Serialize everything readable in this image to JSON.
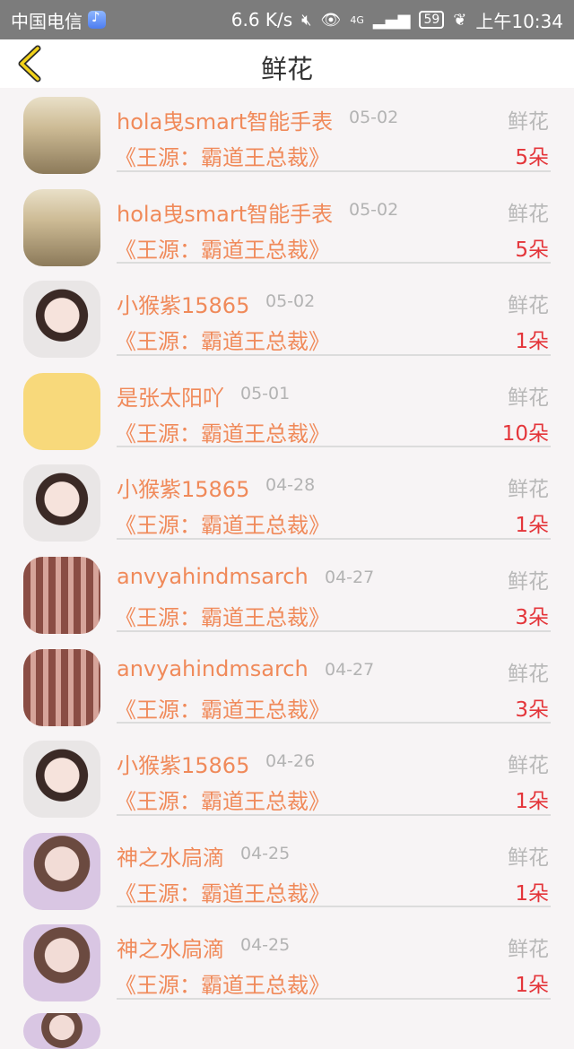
{
  "status_bar": {
    "carrier": "中国电信",
    "speed": "6.6 K/s",
    "signal": "4G",
    "battery": "59",
    "time": "上午10:34"
  },
  "header": {
    "title": "鲜花",
    "back_icon": "chevron-left-icon"
  },
  "rows": [
    {
      "name": "hola曳smart智能手表",
      "date": "05-02",
      "type": "鲜花",
      "work": "《王源：霸道王总裁》",
      "count": "5朵",
      "avatar": "alpaca"
    },
    {
      "name": "hola曳smart智能手表",
      "date": "05-02",
      "type": "鲜花",
      "work": "《王源：霸道王总裁》",
      "count": "5朵",
      "avatar": "alpaca"
    },
    {
      "name": "小猴紫15865",
      "date": "05-02",
      "type": "鲜花",
      "work": "《王源：霸道王总裁》",
      "count": "1朵",
      "avatar": "girl"
    },
    {
      "name": "是张太阳吖",
      "date": "05-01",
      "type": "鲜花",
      "work": "《王源：霸道王总裁》",
      "count": "10朵",
      "avatar": "lion"
    },
    {
      "name": "小猴紫15865",
      "date": "04-28",
      "type": "鲜花",
      "work": "《王源：霸道王总裁》",
      "count": "1朵",
      "avatar": "girl"
    },
    {
      "name": "anvyahindmsarch",
      "date": "04-27",
      "type": "鲜花",
      "work": "《王源：霸道王总裁》",
      "count": "3朵",
      "avatar": "pattern"
    },
    {
      "name": "anvyahindmsarch",
      "date": "04-27",
      "type": "鲜花",
      "work": "《王源：霸道王总裁》",
      "count": "3朵",
      "avatar": "pattern"
    },
    {
      "name": "小猴紫15865",
      "date": "04-26",
      "type": "鲜花",
      "work": "《王源：霸道王总裁》",
      "count": "1朵",
      "avatar": "girl"
    },
    {
      "name": "神之水扃滴",
      "date": "04-25",
      "type": "鲜花",
      "work": "《王源：霸道王总裁》",
      "count": "1朵",
      "avatar": "girl2"
    },
    {
      "name": "神之水扃滴",
      "date": "04-25",
      "type": "鲜花",
      "work": "《王源：霸道王总裁》",
      "count": "1朵",
      "avatar": "girl2"
    }
  ]
}
